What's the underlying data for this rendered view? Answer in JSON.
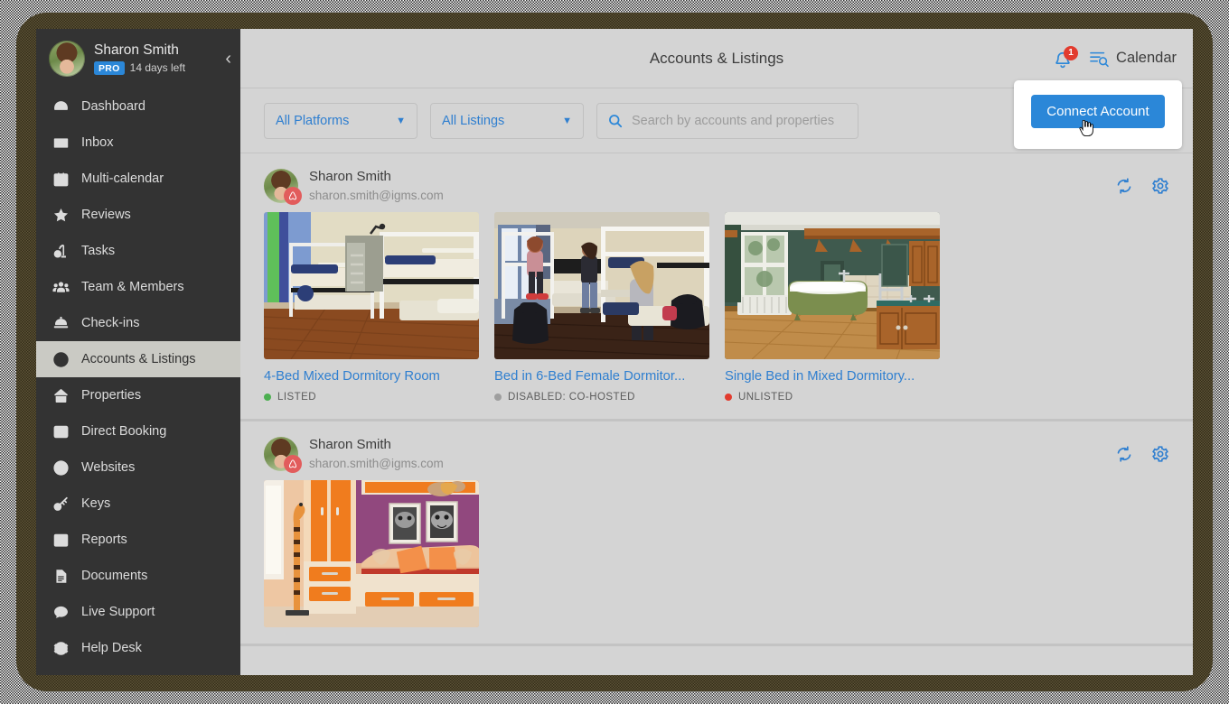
{
  "sidebar": {
    "profile": {
      "name": "Sharon Smith",
      "badge": "PRO",
      "trial": "14 days left",
      "collapse_icon": "chevron-left-icon"
    },
    "items": [
      {
        "label": "Dashboard",
        "icon": "dashboard-icon",
        "active": false
      },
      {
        "label": "Inbox",
        "icon": "inbox-icon",
        "active": false
      },
      {
        "label": "Multi-calendar",
        "icon": "calendar-icon",
        "active": false
      },
      {
        "label": "Reviews",
        "icon": "star-icon",
        "active": false
      },
      {
        "label": "Tasks",
        "icon": "vacuum-icon",
        "active": false
      },
      {
        "label": "Team & Members",
        "icon": "people-icon",
        "active": false
      },
      {
        "label": "Check-ins",
        "icon": "bell-desk-icon",
        "active": false
      },
      {
        "label": "Accounts & Listings",
        "icon": "user-circle-icon",
        "active": true
      },
      {
        "label": "Properties",
        "icon": "home-icon",
        "active": false
      },
      {
        "label": "Direct Booking",
        "icon": "code-window-icon",
        "active": false
      },
      {
        "label": "Websites",
        "icon": "globe-icon",
        "active": false
      },
      {
        "label": "Keys",
        "icon": "key-icon",
        "active": false
      },
      {
        "label": "Reports",
        "icon": "bar-chart-icon",
        "active": false
      },
      {
        "label": "Documents",
        "icon": "document-icon",
        "active": false
      },
      {
        "label": "Live Support",
        "icon": "chat-icon",
        "active": false
      },
      {
        "label": "Help Desk",
        "icon": "lifebuoy-icon",
        "active": false
      }
    ]
  },
  "header": {
    "title": "Accounts & Listings",
    "notifications": {
      "icon": "bell-icon",
      "count": "1"
    },
    "calendar": {
      "icon": "calendar-search-icon",
      "label": "Calendar"
    }
  },
  "filters": {
    "platform": {
      "value": "All Platforms",
      "chevron": "chevron-down-icon"
    },
    "listings": {
      "value": "All Listings",
      "chevron": "chevron-down-icon"
    },
    "search": {
      "icon": "search-icon",
      "value": "",
      "placeholder": "Search by accounts and properties"
    },
    "connect_button": "Connect Account",
    "cursor": "hand-pointer-cursor"
  },
  "colors": {
    "accent_blue": "#2b87d8",
    "link_blue": "#2f7fd0",
    "badge_red": "#e23b2e",
    "sidebar_bg": "#333333",
    "status_listed": "#4caf50",
    "status_disabled": "#9e9e9e",
    "status_unlisted": "#e23b2e"
  },
  "accounts": [
    {
      "name": "Sharon Smith",
      "email": "sharon.smith@igms.com",
      "platform_icon": "airbnb-icon",
      "actions": [
        {
          "name": "sync-icon"
        },
        {
          "name": "settings-gear-icon"
        }
      ],
      "listings": [
        {
          "title": "4-Bed Mixed Dormitory Room",
          "status": "LISTED",
          "status_color": "#4caf50",
          "image": "bunk-bed-dorm-room"
        },
        {
          "title": "Bed in 6-Bed Female Dormitor...",
          "status": "DISABLED: CO-HOSTED",
          "status_color": "#9e9e9e",
          "image": "female-dorm-with-guests"
        },
        {
          "title": "Single Bed in Mixed Dormitory...",
          "status": "UNLISTED",
          "status_color": "#e23b2e",
          "image": "green-bathroom-clawfoot-tub"
        }
      ]
    },
    {
      "name": "Sharon Smith",
      "email": "sharon.smith@igms.com",
      "platform_icon": "airbnb-icon",
      "actions": [
        {
          "name": "sync-icon"
        },
        {
          "name": "settings-gear-icon"
        }
      ],
      "listings": [
        {
          "title": "",
          "status": "",
          "status_color": "#9e9e9e",
          "image": "orange-purple-kids-room"
        }
      ]
    }
  ]
}
